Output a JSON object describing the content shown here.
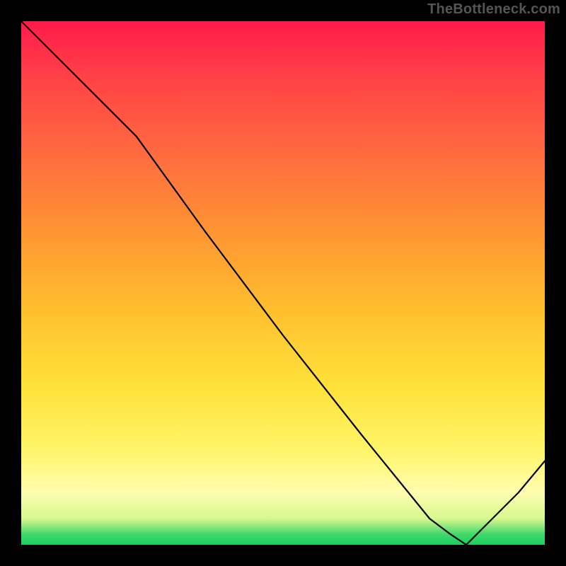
{
  "watermark": "TheBottleneck.com",
  "xlabel_marker": "",
  "chart_data": {
    "type": "line",
    "title": "",
    "xlabel": "",
    "ylabel": "",
    "xlim": [
      0,
      100
    ],
    "ylim": [
      0,
      100
    ],
    "legend": false,
    "grid": false,
    "background": "vertical-gradient red→orange→yellow→pale→green",
    "notes": "Line chart over a heat-map-style gradient. Curve starts at top-left, descends with a slope break near x≈22, reaches minimum near x≈85, then rises toward the right edge.",
    "series": [
      {
        "name": "curve",
        "x": [
          0,
          10,
          22,
          35,
          50,
          65,
          78,
          82,
          85,
          90,
          95,
          100
        ],
        "y": [
          100,
          90,
          78,
          60,
          40,
          21,
          5,
          2,
          0,
          5,
          10,
          16
        ]
      }
    ],
    "annotations": [
      {
        "type": "marker",
        "x": 84,
        "y": 0,
        "color": "#b00020",
        "text": ""
      }
    ]
  }
}
